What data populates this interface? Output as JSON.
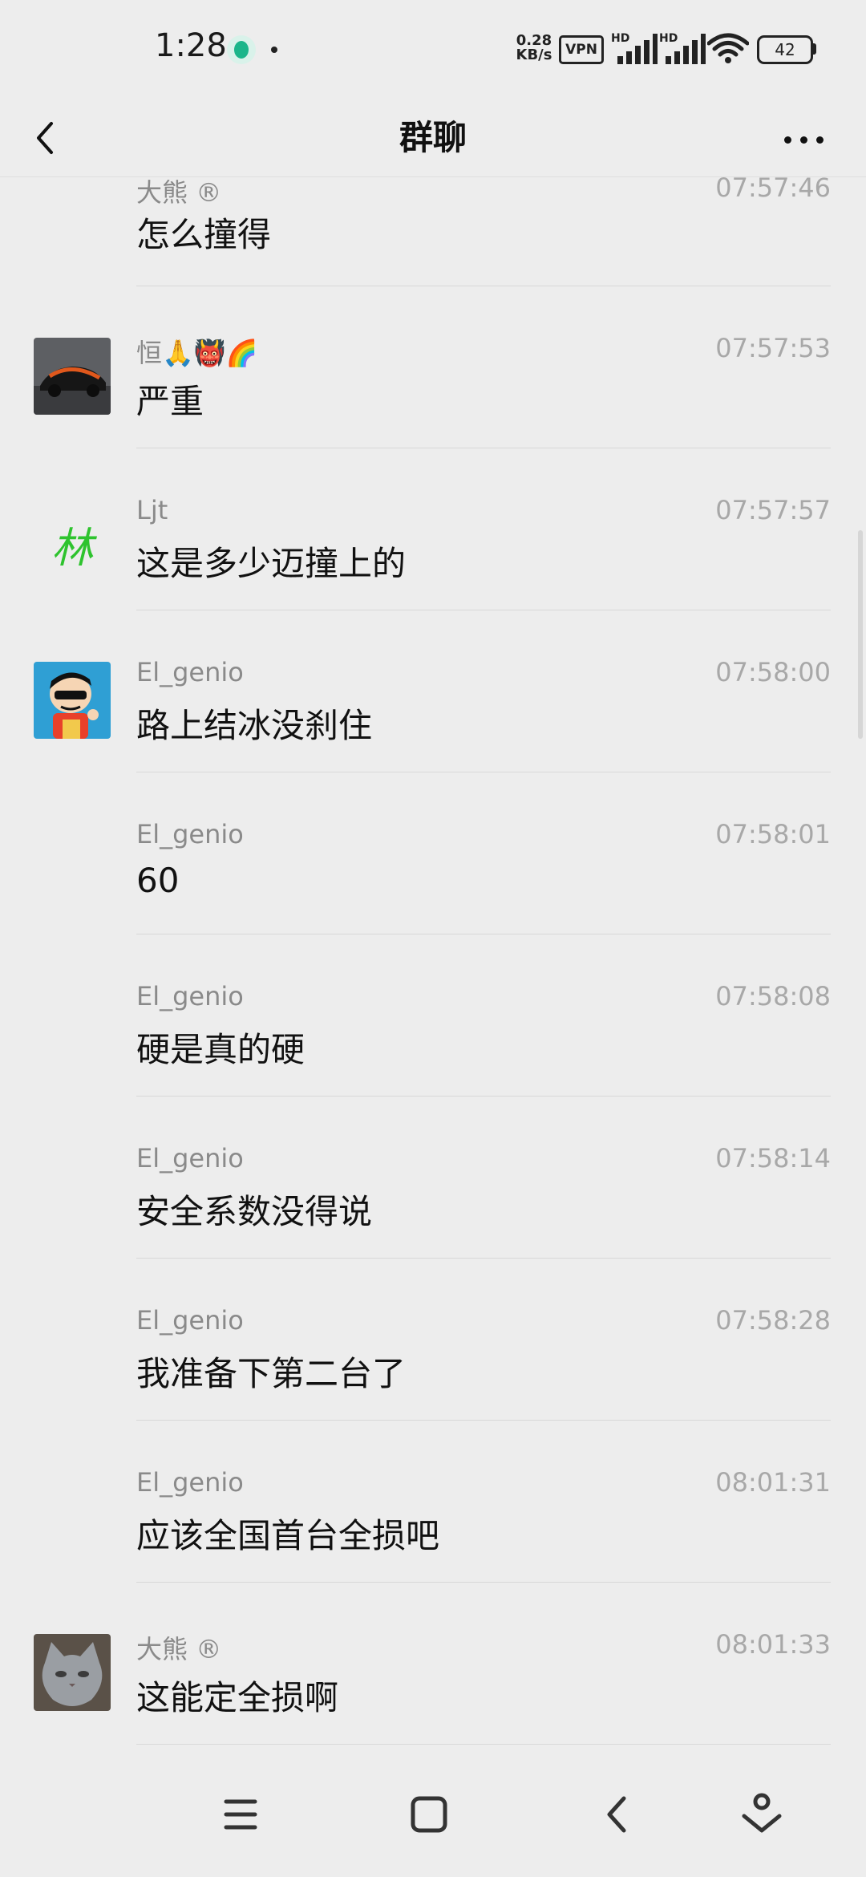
{
  "status_bar": {
    "time": "1:28",
    "net_speed_value": "0.28",
    "net_speed_unit": "KB/s",
    "vpn": "VPN",
    "signal_label": "HD",
    "battery": "42"
  },
  "header": {
    "title": "群聊"
  },
  "messages": [
    {
      "sender": "大熊",
      "time": "07:57:46",
      "text": "怎么撞得"
    },
    {
      "sender": "恒🙏👹🌈",
      "time": "07:57:53",
      "text": "严重"
    },
    {
      "sender": "Ljt",
      "time": "07:57:57",
      "text": "这是多少迈撞上的"
    },
    {
      "sender": "El_genio",
      "time": "07:58:00",
      "text": "路上结冰没刹住"
    },
    {
      "sender": "El_genio",
      "time": "07:58:01",
      "text": "60"
    },
    {
      "sender": "El_genio",
      "time": "07:58:08",
      "text": "硬是真的硬"
    },
    {
      "sender": "El_genio",
      "time": "07:58:14",
      "text": "安全系数没得说"
    },
    {
      "sender": "El_genio",
      "time": "07:58:28",
      "text": "我准备下第二台了"
    },
    {
      "sender": "El_genio",
      "time": "08:01:31",
      "text": "应该全国首台全损吧"
    },
    {
      "sender": "大熊",
      "time": "08:01:33",
      "text": "这能定全损啊"
    }
  ],
  "sender_marks": {
    "registered": "®",
    "avatar_ljt_glyph": "林"
  },
  "icons": {
    "back": "chevron-left-icon",
    "more": "more-dots-icon",
    "menu": "menu-icon",
    "home": "home-square-icon",
    "sys_back": "system-back-icon",
    "assistant": "assistant-icon"
  },
  "colors": {
    "background": "#ededed",
    "divider": "#d8d8d8",
    "sender_text": "#8a8a8a",
    "time_text": "#a8a8a8",
    "message_text": "#111111"
  }
}
